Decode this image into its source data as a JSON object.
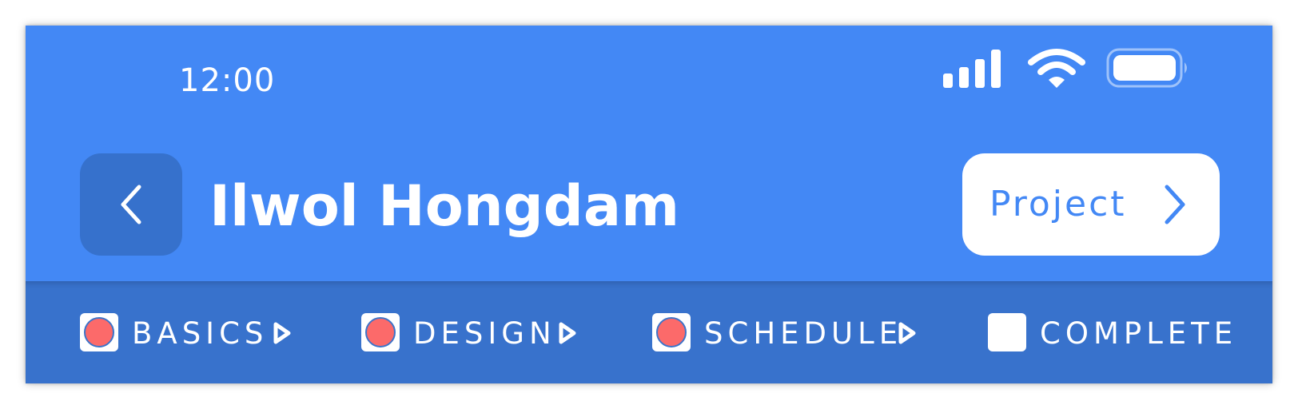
{
  "status_bar": {
    "time": "12:00",
    "icons": [
      "cellular-signal-icon",
      "wifi-icon",
      "battery-icon"
    ]
  },
  "header": {
    "back_icon": "chevron-left-icon",
    "title": "Ilwol Hongdam",
    "project_button_label": "Project",
    "project_icon": "chevron-right-icon"
  },
  "steps": {
    "items": [
      {
        "label": "BASICS",
        "done": true
      },
      {
        "label": "DESIGN",
        "done": true
      },
      {
        "label": "SCHEDULE",
        "done": true
      },
      {
        "label": "COMPLETE",
        "done": false
      }
    ],
    "separator_icon": "play-arrow-icon"
  },
  "colors": {
    "header_bg": "#4388F5",
    "steps_bg": "#3872CC",
    "back_button_bg": "#3671CC",
    "step_dot": "#FC6A6A",
    "white": "#FFFFFF"
  }
}
